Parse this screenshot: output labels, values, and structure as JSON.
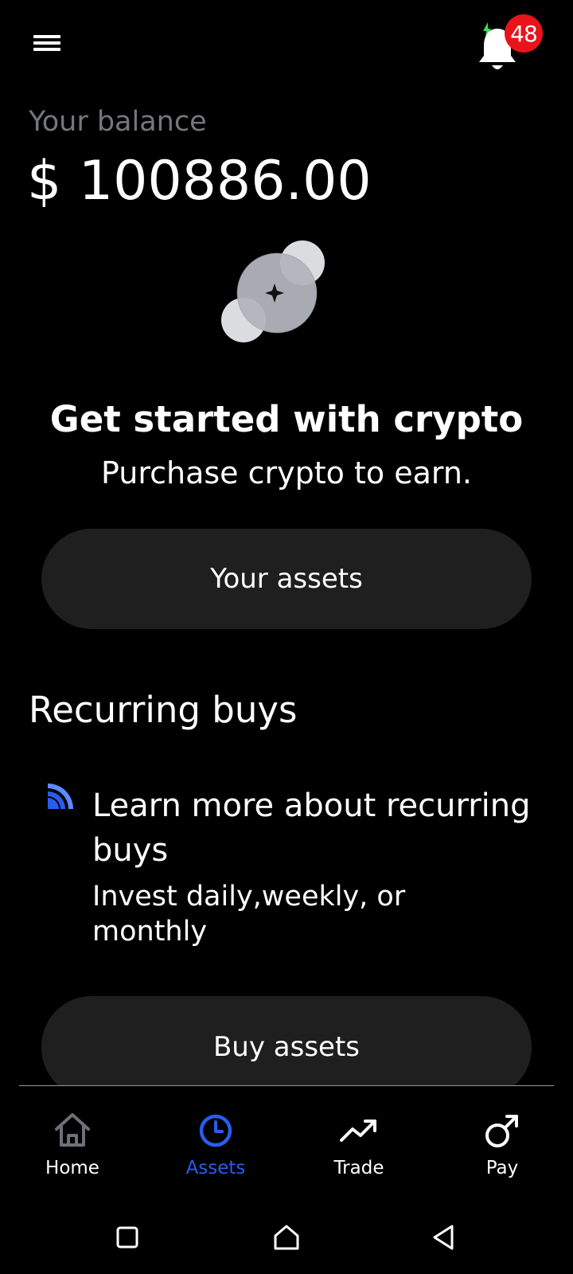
{
  "header": {
    "menu_icon": "menu-icon",
    "bell_icon": "bell-icon",
    "notification_count": "48"
  },
  "balance": {
    "label": "Your balance",
    "amount": "$ 100886.00"
  },
  "empty_state": {
    "illustration": "coins-illustration",
    "title": "Get started with crypto",
    "subtitle": "Purchase crypto to earn."
  },
  "buttons": {
    "your_assets": "Your assets",
    "buy_assets": "Buy assets"
  },
  "recurring": {
    "section_title": "Recurring buys",
    "icon": "wifi-icon",
    "learn_title": "Learn more about recurring buys",
    "learn_subtitle": "Invest daily,weekly, or monthly"
  },
  "bottom_nav": {
    "active": "Assets",
    "items": [
      {
        "label": "Home",
        "icon": "home-icon"
      },
      {
        "label": "Assets",
        "icon": "clock-icon"
      },
      {
        "label": "Trade",
        "icon": "trending-up-icon"
      },
      {
        "label": "Pay",
        "icon": "pay-icon"
      }
    ]
  },
  "colors": {
    "background": "#000000",
    "card": "#1f1f1f",
    "accent": "#2a5cf0",
    "badge": "#e8131b",
    "muted_text": "#74777f"
  }
}
